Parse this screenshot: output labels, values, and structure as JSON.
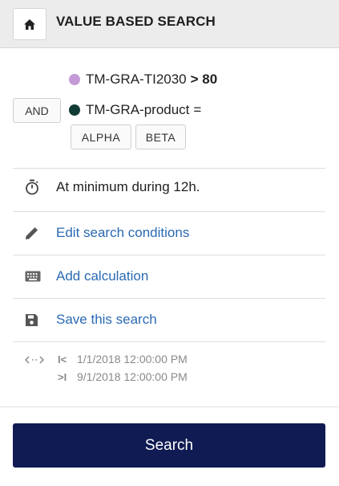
{
  "header": {
    "title": "VALUE BASED SEARCH",
    "home_icon": "home-icon"
  },
  "conditions": {
    "first": {
      "tag": "TM-GRA-TI2030",
      "operator_value": "> 80",
      "color": "#c49bd6"
    },
    "combinator": "AND",
    "second": {
      "tag": "TM-GRA-product",
      "operator": "=",
      "color": "#123b36",
      "values": [
        "ALPHA",
        "BETA"
      ]
    }
  },
  "duration": {
    "icon": "stopwatch-icon",
    "text": "At minimum during 12h."
  },
  "actions": {
    "edit": {
      "icon": "pencil-icon",
      "label": "Edit search conditions"
    },
    "calc": {
      "icon": "keyboard-icon",
      "label": "Add calculation"
    },
    "save": {
      "icon": "save-icon",
      "label": "Save this search"
    }
  },
  "time_range": {
    "icon": "range-arrows-icon",
    "start_mark": "I<",
    "start": "1/1/2018 12:00:00 PM",
    "end_mark": ">I",
    "end": "9/1/2018 12:00:00 PM"
  },
  "search_button": {
    "label": "Search"
  },
  "colors": {
    "accent": "#0f1b52",
    "link": "#2a6ab4"
  }
}
